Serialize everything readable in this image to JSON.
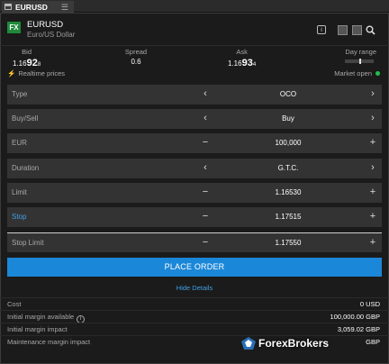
{
  "tab": {
    "title": "EURUSD",
    "menu_icon": "hamburger-icon"
  },
  "header": {
    "badge": "FX",
    "name": "EURUSD",
    "description": "Euro/US Dollar",
    "icons": [
      "info-icon",
      "chart-icon",
      "chart-alt-icon",
      "search-icon"
    ]
  },
  "prices": {
    "bid_label": "Bid",
    "bid_prefix": "1.16",
    "bid_big": "92",
    "bid_small": "8",
    "spread_label": "Spread",
    "spread_value": "0.6",
    "ask_label": "Ask",
    "ask_prefix": "1.16",
    "ask_big": "93",
    "ask_small": "4",
    "day_range_label": "Day range",
    "realtime": "Realtime prices",
    "market": "Market open"
  },
  "form": {
    "rows": [
      {
        "label": "Type",
        "value": "OCO",
        "left_icon": "chevron-left-icon",
        "left_glyph": "‹",
        "right_icon": "chevron-right-icon",
        "right_glyph": "›"
      },
      {
        "label": "Buy/Sell",
        "value": "Buy",
        "left_icon": "chevron-left-icon",
        "left_glyph": "‹",
        "right_icon": "chevron-right-icon",
        "right_glyph": "›"
      },
      {
        "label": "EUR",
        "value": "100,000",
        "left_icon": "minus-icon",
        "left_glyph": "−",
        "right_icon": "plus-icon",
        "right_glyph": "+"
      },
      {
        "label": "Duration",
        "value": "G.T.C.",
        "left_icon": "chevron-left-icon",
        "left_glyph": "‹",
        "right_icon": "chevron-right-icon",
        "right_glyph": "›"
      },
      {
        "label": "Limit",
        "value": "1.16530",
        "left_icon": "minus-icon",
        "left_glyph": "−",
        "right_icon": "plus-icon",
        "right_glyph": "+"
      },
      {
        "label": "Stop",
        "value": "1.17515",
        "left_icon": "minus-icon",
        "left_glyph": "−",
        "right_icon": "plus-icon",
        "right_glyph": "+"
      },
      {
        "label": "Stop Limit",
        "value": "1.17550",
        "left_icon": "minus-icon",
        "left_glyph": "−",
        "right_icon": "plus-icon",
        "right_glyph": "+"
      }
    ]
  },
  "place_order": "PLACE ORDER",
  "hide_details": "Hide Details",
  "details": [
    {
      "label": "Cost",
      "value": "0 USD"
    },
    {
      "label": "Initial margin available",
      "value": "100,000.00 GBP",
      "info": "i"
    },
    {
      "label": "Initial margin impact",
      "value": "3,059.02 GBP"
    },
    {
      "label": "Maintenance margin impact",
      "value": "GBP"
    }
  ],
  "watermark": "ForexBrokers",
  "colors": {
    "accent": "#1b87d8",
    "link": "#3fa0e6",
    "fx_badge": "#1f8a3a",
    "market_open": "#1fc14b"
  }
}
